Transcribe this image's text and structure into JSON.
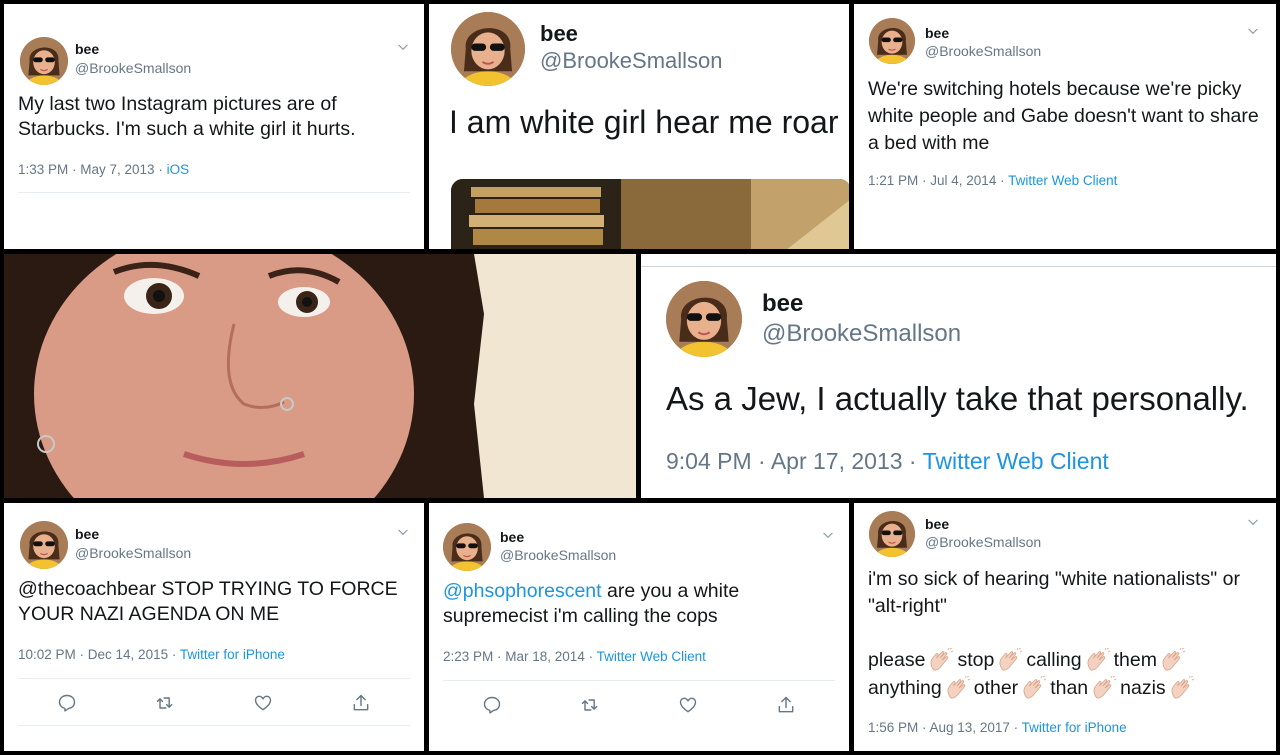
{
  "profile": {
    "name": "bee",
    "handle": "@BrookeSmallson"
  },
  "tweets": [
    {
      "body": "My last two Instagram pictures are of Starbucks. I'm such a white girl it hurts.",
      "time": "1:33 PM · May 7, 2013 · ",
      "source": "iOS"
    },
    {
      "body": "I am white girl hear me roar"
    },
    {
      "body": "We're switching hotels because we're picky white people and Gabe doesn't want to share a bed with me",
      "time": "1:21 PM · Jul 4, 2014 · ",
      "source": "Twitter Web Client"
    },
    {
      "body": "As a Jew, I actually take that personally.",
      "time": "9:04 PM · Apr 17, 2013 · ",
      "source": "Twitter Web Client"
    },
    {
      "body": "@thecoachbear STOP TRYING TO FORCE YOUR NAZI AGENDA ON ME",
      "time": "10:02 PM · Dec 14, 2015 · ",
      "source": "Twitter for iPhone"
    },
    {
      "mention": "@phsophorescent",
      "body": " are you a white supremecist i'm calling the cops",
      "time": "2:23 PM · Mar 18, 2014 · ",
      "source": "Twitter Web Client"
    },
    {
      "body": "i'm so sick of hearing \"white nationalists\" or \"alt-right\"",
      "words": [
        "please",
        "stop",
        "calling",
        "them",
        "anything",
        "other",
        "than",
        "nazis"
      ],
      "time": "1:56 PM · Aug 13, 2017 · ",
      "source": "Twitter for iPhone"
    }
  ],
  "icons": {
    "reply": "reply-icon",
    "retweet": "retweet-icon",
    "like": "heart-icon",
    "share": "share-icon",
    "clap": "clapping-hands-icon",
    "more": "chevron-down-icon"
  },
  "colors": {
    "link": "#1b95e0",
    "meta": "#657786",
    "text": "#14171a",
    "divider": "#e6ecf0",
    "background": "#000000"
  }
}
